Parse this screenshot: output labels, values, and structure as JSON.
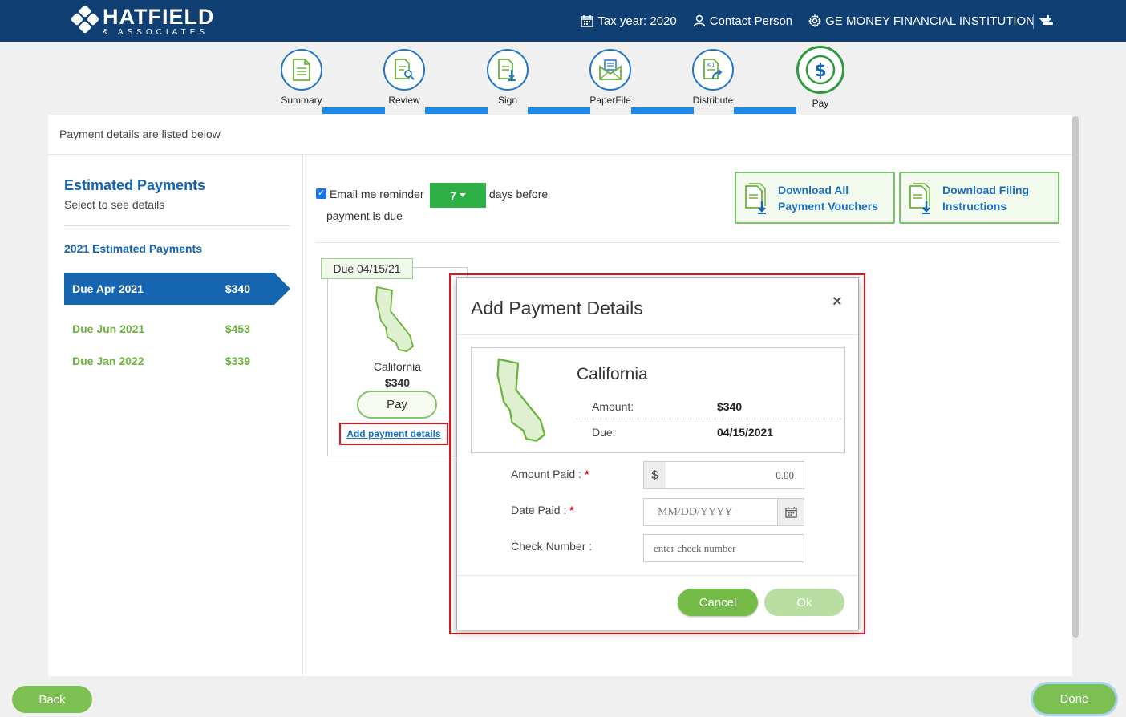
{
  "header": {
    "logo_main": "HATFIELD",
    "logo_sub": "& ASSOCIATES",
    "tax_year": "Tax year: 2020",
    "contact": "Contact Person",
    "institution": "GE MONEY FINANCIAL INSTITUTION",
    "icons": [
      "calendar-icon",
      "person-icon",
      "gear-icon",
      "download-icon"
    ]
  },
  "stepper": {
    "steps": [
      {
        "label": "Summary",
        "icon": "document-icon"
      },
      {
        "label": "Review",
        "icon": "review-icon"
      },
      {
        "label": "Sign",
        "icon": "sign-icon"
      },
      {
        "label": "PaperFile",
        "icon": "envelope-icon"
      },
      {
        "label": "Distribute",
        "icon": "distribute-icon"
      },
      {
        "label": "Pay",
        "icon": "dollar-icon"
      }
    ],
    "active": "Pay"
  },
  "panel": {
    "heading": "Payment details are listed below"
  },
  "sidebar": {
    "title": "Estimated Payments",
    "subtitle": "Select to see details",
    "year_heading": "2021 Estimated Payments",
    "items": [
      {
        "label": "Due Apr 2021",
        "amount": "$340",
        "active": true
      },
      {
        "label": "Due Jun 2021",
        "amount": "$453",
        "active": false
      },
      {
        "label": "Due Jan 2022",
        "amount": "$339",
        "active": false
      }
    ]
  },
  "reminder": {
    "checked": true,
    "prefix": "Email me reminder",
    "days": "7",
    "suffix": "days before",
    "suffix2": "payment is due"
  },
  "buttons": {
    "download_vouchers_1": "Download All",
    "download_vouchers_2": "Payment Vouchers",
    "download_instructions_1": "Download Filing",
    "download_instructions_2": "Instructions",
    "back": "Back",
    "done": "Done"
  },
  "card": {
    "due_tag": "Due 04/15/21",
    "state": "California",
    "amount": "$340",
    "pay_label": "Pay",
    "add_link": "Add payment details"
  },
  "modal": {
    "title": "Add Payment Details",
    "close": "×",
    "state": "California",
    "amount_label": "Amount:",
    "amount_value": "$340",
    "due_label": "Due:",
    "due_value": "04/15/2021",
    "fields": {
      "amount_paid_label": "Amount Paid :",
      "amount_paid_addon": "$",
      "amount_paid_value": "0.00",
      "date_paid_label": "Date Paid :",
      "date_paid_placeholder": "MM/DD/YYYY",
      "check_number_label": "Check Number :",
      "check_number_placeholder": "enter check number"
    },
    "cancel": "Cancel",
    "ok": "Ok"
  },
  "colors": {
    "header_bg": "#0f3f73",
    "accent_blue": "#1565b0",
    "accent_green": "#74bb47",
    "highlight_red": "#e0161e"
  }
}
